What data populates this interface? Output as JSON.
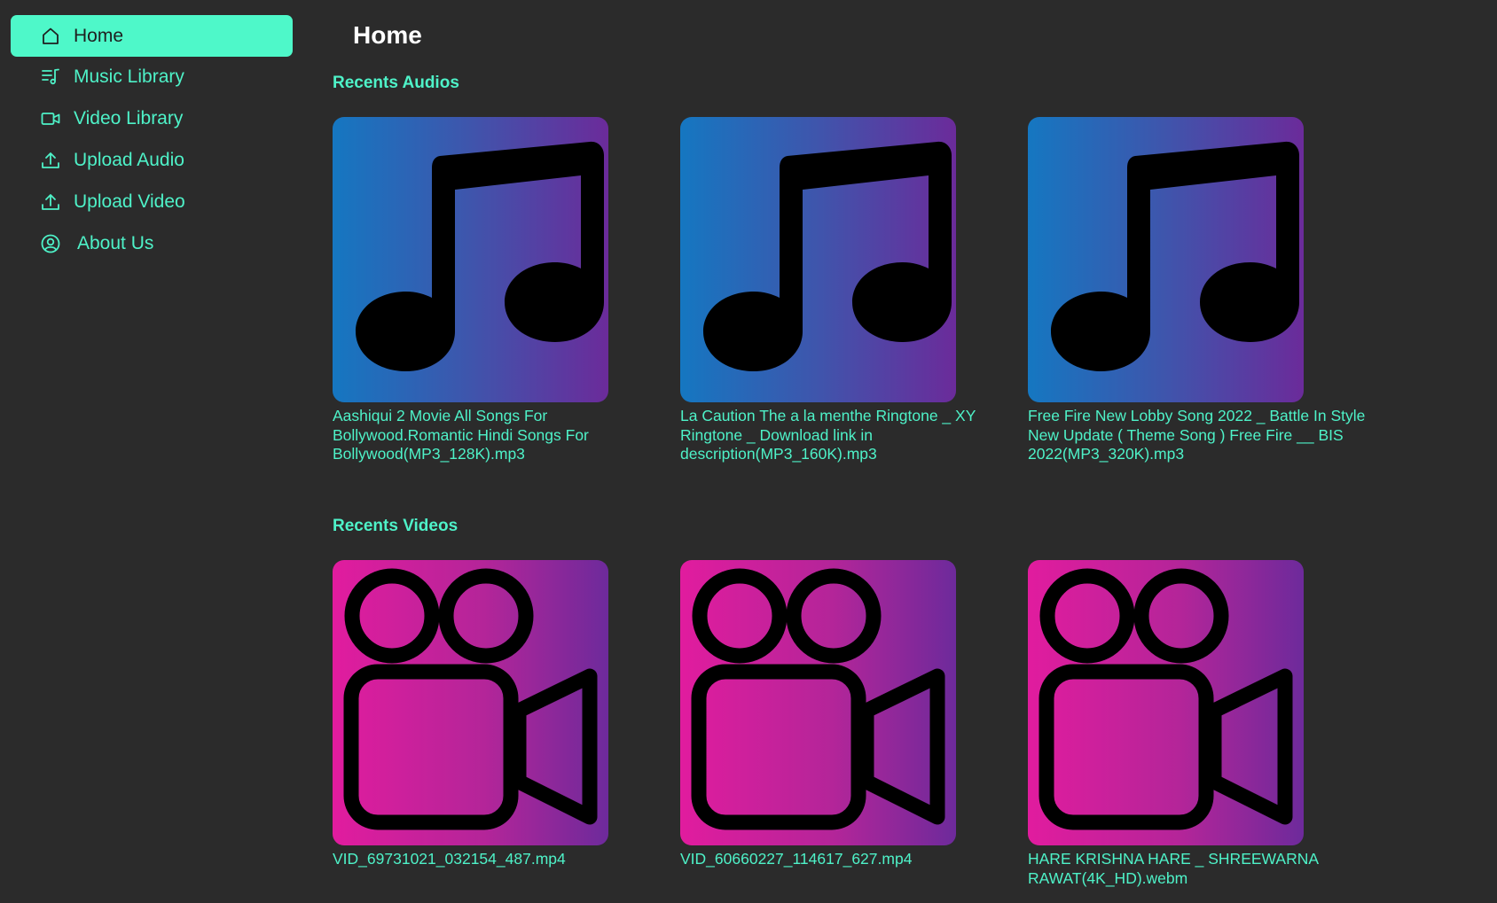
{
  "sidebar": {
    "items": [
      {
        "label": "Home",
        "icon": "home-icon",
        "active": true
      },
      {
        "label": "Music Library",
        "icon": "music-list-icon",
        "active": false
      },
      {
        "label": "Video Library",
        "icon": "video-camera-icon",
        "active": false
      },
      {
        "label": "Upload Audio",
        "icon": "upload-icon",
        "active": false
      },
      {
        "label": "Upload Video",
        "icon": "upload-icon",
        "active": false
      },
      {
        "label": "About Us",
        "icon": "user-circle-icon",
        "active": false
      }
    ]
  },
  "main": {
    "title": "Home",
    "audios": {
      "heading": "Recents Audios",
      "items": [
        {
          "title": "Aashiqui 2 Movie All Songs For Bollywood.Romantic Hindi Songs For Bollywood(MP3_128K).mp3",
          "icon": "music-note-icon"
        },
        {
          "title": "La Caution The a la menthe Ringtone _ XY Ringtone _ Download link in description(MP3_160K).mp3",
          "icon": "music-note-icon"
        },
        {
          "title": "Free Fire New Lobby Song 2022 _ Battle In Style New Update ( Theme Song ) Free Fire __ BIS 2022(MP3_320K).mp3",
          "icon": "music-note-icon"
        }
      ]
    },
    "videos": {
      "heading": "Recents Videos",
      "items": [
        {
          "title": "VID_69731021_032154_487.mp4",
          "icon": "movie-camera-icon"
        },
        {
          "title": "VID_60660227_114617_627.mp4",
          "icon": "movie-camera-icon"
        },
        {
          "title": "HARE KRISHNA HARE _ SHREEWARNA RAWAT(4K_HD).webm",
          "icon": "movie-camera-icon"
        }
      ]
    }
  },
  "colors": {
    "background": "#2b2b2b",
    "accent": "#4ef2c8",
    "active_bg": "#4ef8c9",
    "audio_gradient": [
      "#1577c1",
      "#6b2b9a"
    ],
    "video_gradient": [
      "#e11c9e",
      "#6d2a9b"
    ]
  }
}
